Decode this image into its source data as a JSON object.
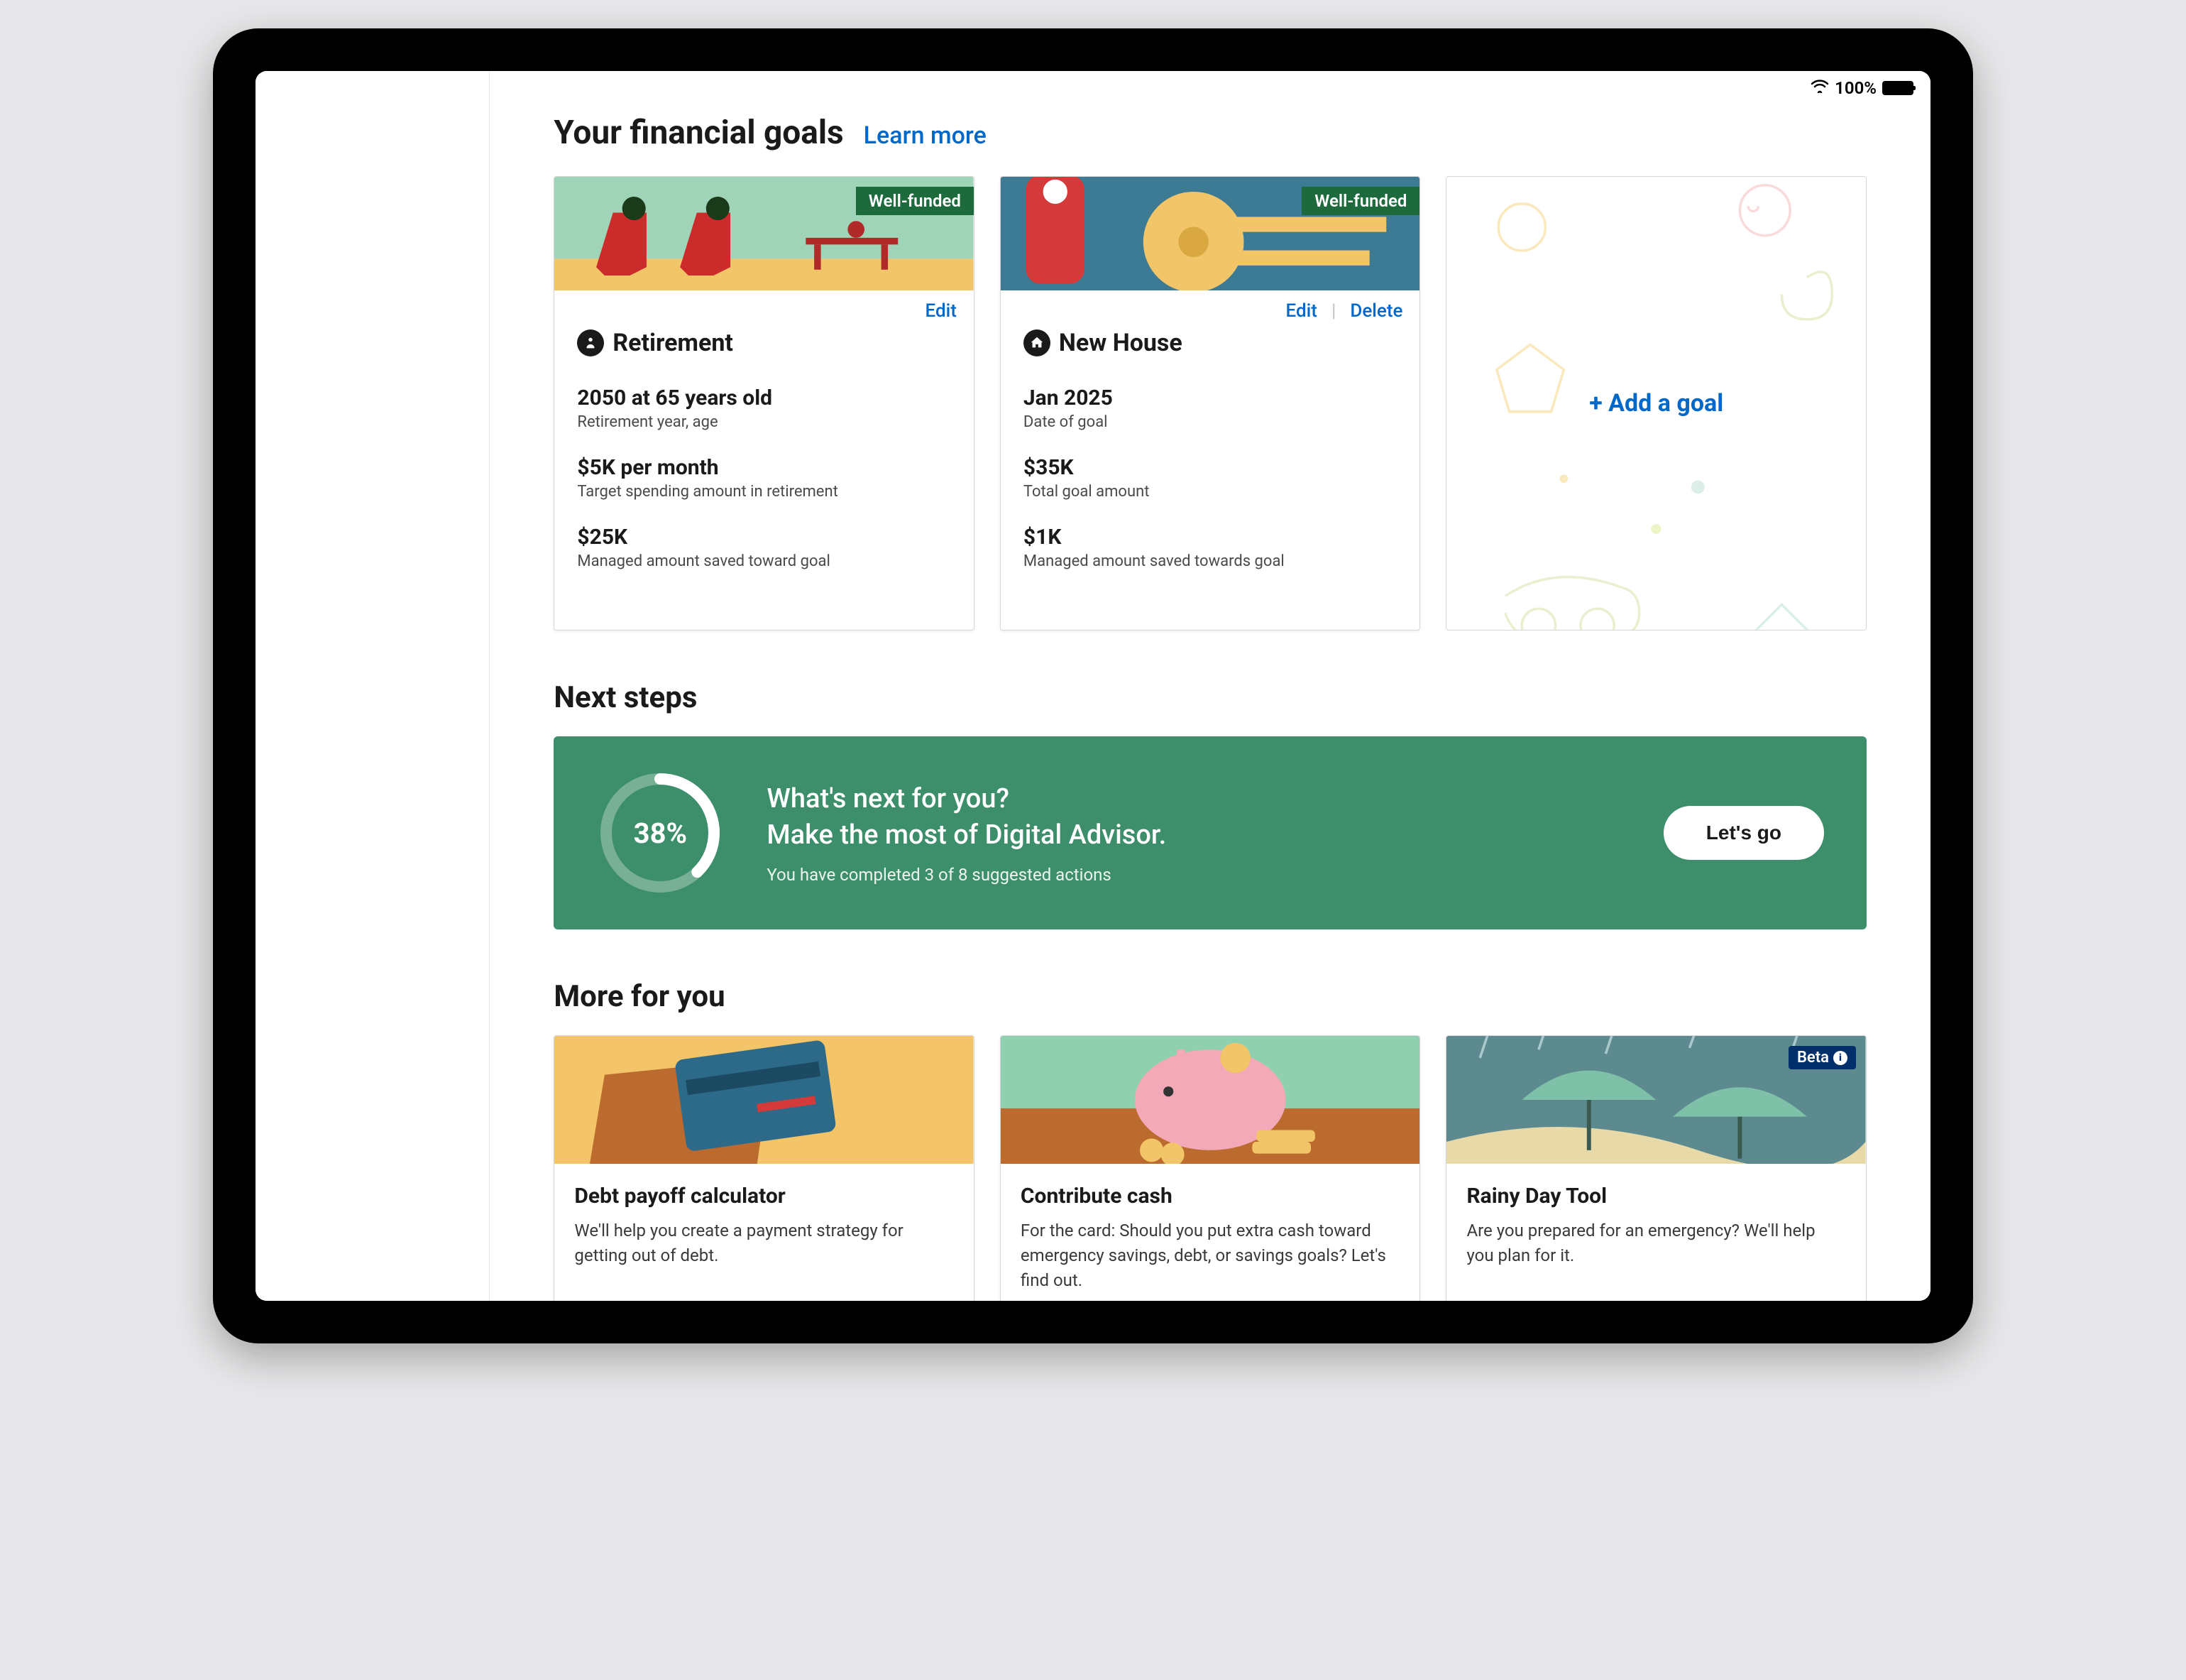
{
  "status_bar": {
    "battery_pct": "100%"
  },
  "header": {
    "title": "Your financial goals",
    "learn_more": "Learn more"
  },
  "goals": [
    {
      "badge": "Well-funded",
      "edit": "Edit",
      "title": "Retirement",
      "stats": [
        {
          "value": "2050 at 65 years old",
          "label": "Retirement year, age"
        },
        {
          "value": "$5K per month",
          "label": "Target spending amount in retirement"
        },
        {
          "value": "$25K",
          "label": "Managed amount saved toward goal"
        }
      ]
    },
    {
      "badge": "Well-funded",
      "edit": "Edit",
      "delete": "Delete",
      "title": "New House",
      "stats": [
        {
          "value": "Jan 2025",
          "label": "Date of goal"
        },
        {
          "value": "$35K",
          "label": "Total goal amount"
        },
        {
          "value": "$1K",
          "label": "Managed amount saved towards goal"
        }
      ]
    }
  ],
  "add_goal": {
    "label": "+ Add a goal"
  },
  "next_steps": {
    "heading": "Next steps",
    "percent": "38%",
    "headline1": "What's next for you?",
    "headline2": "Make the most of Digital Advisor.",
    "sub": "You have completed 3 of 8 suggested actions",
    "cta": "Let's go"
  },
  "more": {
    "heading": "More for you",
    "cards": [
      {
        "title": "Debt payoff calculator",
        "desc": "We'll help you create a payment strategy for getting out of debt."
      },
      {
        "title": "Contribute cash",
        "desc": "For the card: Should you put extra cash toward emergency savings, debt, or savings goals? Let's find out."
      },
      {
        "title": "Rainy Day Tool",
        "desc": "Are you prepared for an emergency? We'll help you plan for it.",
        "badge": "Beta"
      }
    ]
  }
}
